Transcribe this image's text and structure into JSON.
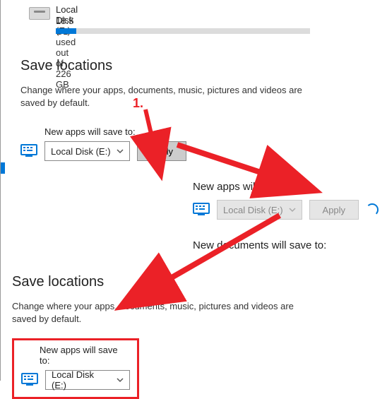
{
  "disk": {
    "label": "Local Disk (E:)",
    "usage_text": "18.5 GB used out of 226 GB",
    "fill_percent": 8
  },
  "section1": {
    "heading": "Save locations",
    "desc": "Change where your apps, documents, music, pictures and videos are saved by default.",
    "field_label": "New apps will save to:",
    "selected": "Local Disk (E:)",
    "apply": "Apply"
  },
  "section2": {
    "field_label": "New apps will save to:",
    "selected": "Local Disk (E:)",
    "apply": "Apply",
    "next_label": "New documents will save to:"
  },
  "section3": {
    "heading": "Save locations",
    "desc": "Change where your apps, documents, music, pictures and videos are saved by default.",
    "field_label": "New apps will save to:",
    "selected": "Local Disk (E:)"
  },
  "annotation": {
    "num1": "1."
  },
  "colors": {
    "accent": "#0078d7",
    "red": "#eb2127"
  }
}
